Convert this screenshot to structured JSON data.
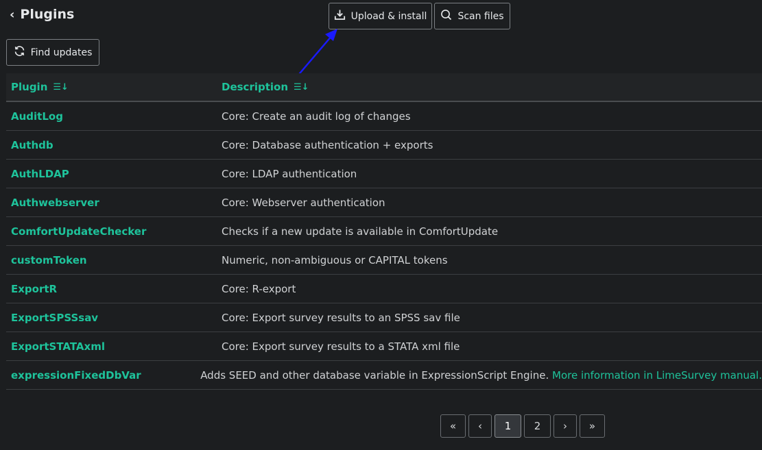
{
  "header": {
    "back_chevron": "‹",
    "title": "Plugins"
  },
  "toolbar": {
    "upload_label": "Upload & install",
    "upload_icon": "download-tray-icon",
    "scan_label": "Scan files",
    "scan_icon": "search-icon",
    "find_updates_label": "Find updates",
    "find_updates_icon": "refresh-icon"
  },
  "table": {
    "columns": [
      {
        "label": "Plugin",
        "sort_icon": "☰↓"
      },
      {
        "label": "Description",
        "sort_icon": "☰↓"
      }
    ],
    "rows": [
      {
        "name": "AuditLog",
        "description": "Core: Create an audit log of changes"
      },
      {
        "name": "Authdb",
        "description": "Core: Database authentication + exports"
      },
      {
        "name": "AuthLDAP",
        "description": "Core: LDAP authentication"
      },
      {
        "name": "Authwebserver",
        "description": "Core: Webserver authentication"
      },
      {
        "name": "ComfortUpdateChecker",
        "description": "Checks if a new update is available in ComfortUpdate"
      },
      {
        "name": "customToken",
        "description": "Numeric, non-ambiguous or CAPITAL tokens"
      },
      {
        "name": "ExportR",
        "description": "Core: R-export"
      },
      {
        "name": "ExportSPSSsav",
        "description": "Core: Export survey results to an SPSS sav file"
      },
      {
        "name": "ExportSTATAxml",
        "description": "Core: Export survey results to a STATA xml file"
      },
      {
        "name": "expressionFixedDbVar",
        "description": "Adds SEED and other database variable in ExpressionScript Engine. ",
        "link": "More information in LimeSurvey manual."
      }
    ]
  },
  "pagination": {
    "first": "«",
    "prev": "‹",
    "pages": [
      "1",
      "2"
    ],
    "current": "1",
    "next": "›",
    "last": "»"
  },
  "colors": {
    "accent": "#1ec39b",
    "background": "#1c1e20",
    "annotation_arrow": "#1a1aff"
  }
}
